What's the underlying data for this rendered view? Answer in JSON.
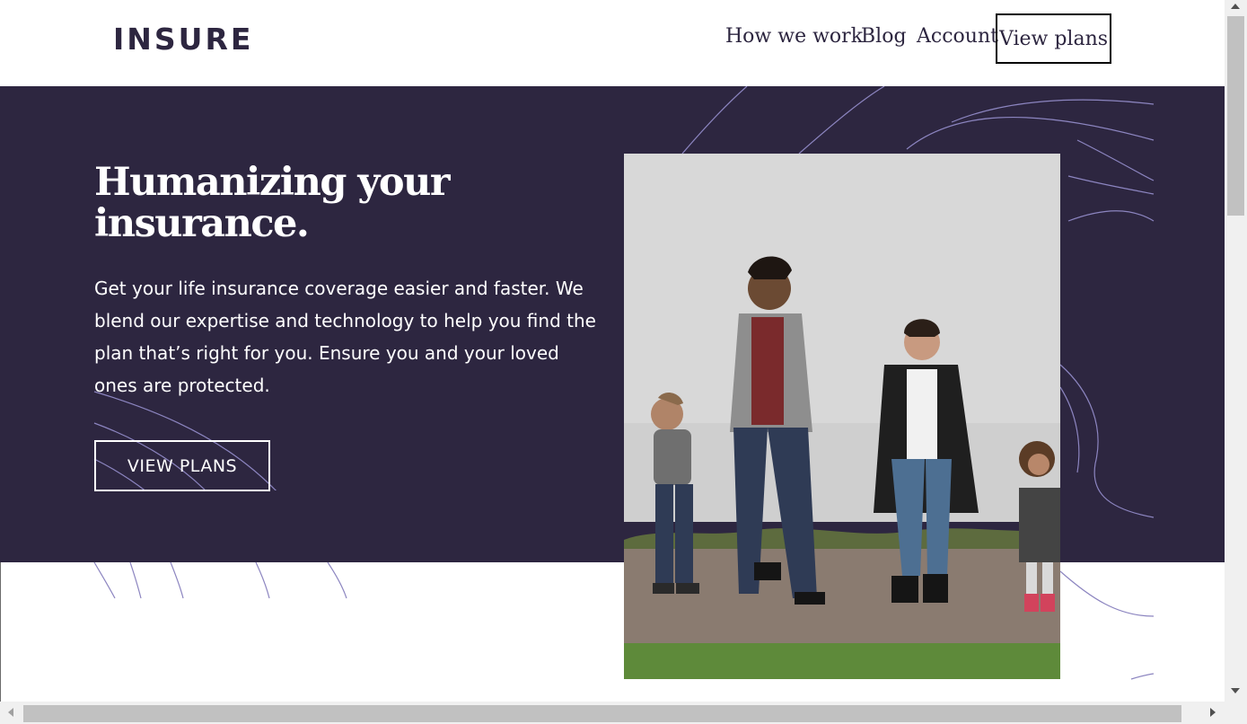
{
  "header": {
    "logo": "INSURE",
    "nav": {
      "how_we_work": "How we work",
      "blog": "Blog",
      "account": "Account",
      "view_plans": "View plans"
    }
  },
  "hero": {
    "title_line1": "Humanizing your",
    "title_line2": "insurance.",
    "description": "Get your life insurance coverage easier and faster. We blend our expertise and technology to help you find the plan that’s right for you. Ensure you and your loved ones are protected.",
    "button": "VIEW PLANS"
  },
  "colors": {
    "brand_dark": "#2d2640",
    "curve_line": "#8c85c0",
    "white": "#ffffff"
  },
  "icons": {
    "scroll_up": "triangle-up",
    "scroll_down": "triangle-down",
    "scroll_left": "triangle-left",
    "scroll_right": "triangle-right"
  }
}
